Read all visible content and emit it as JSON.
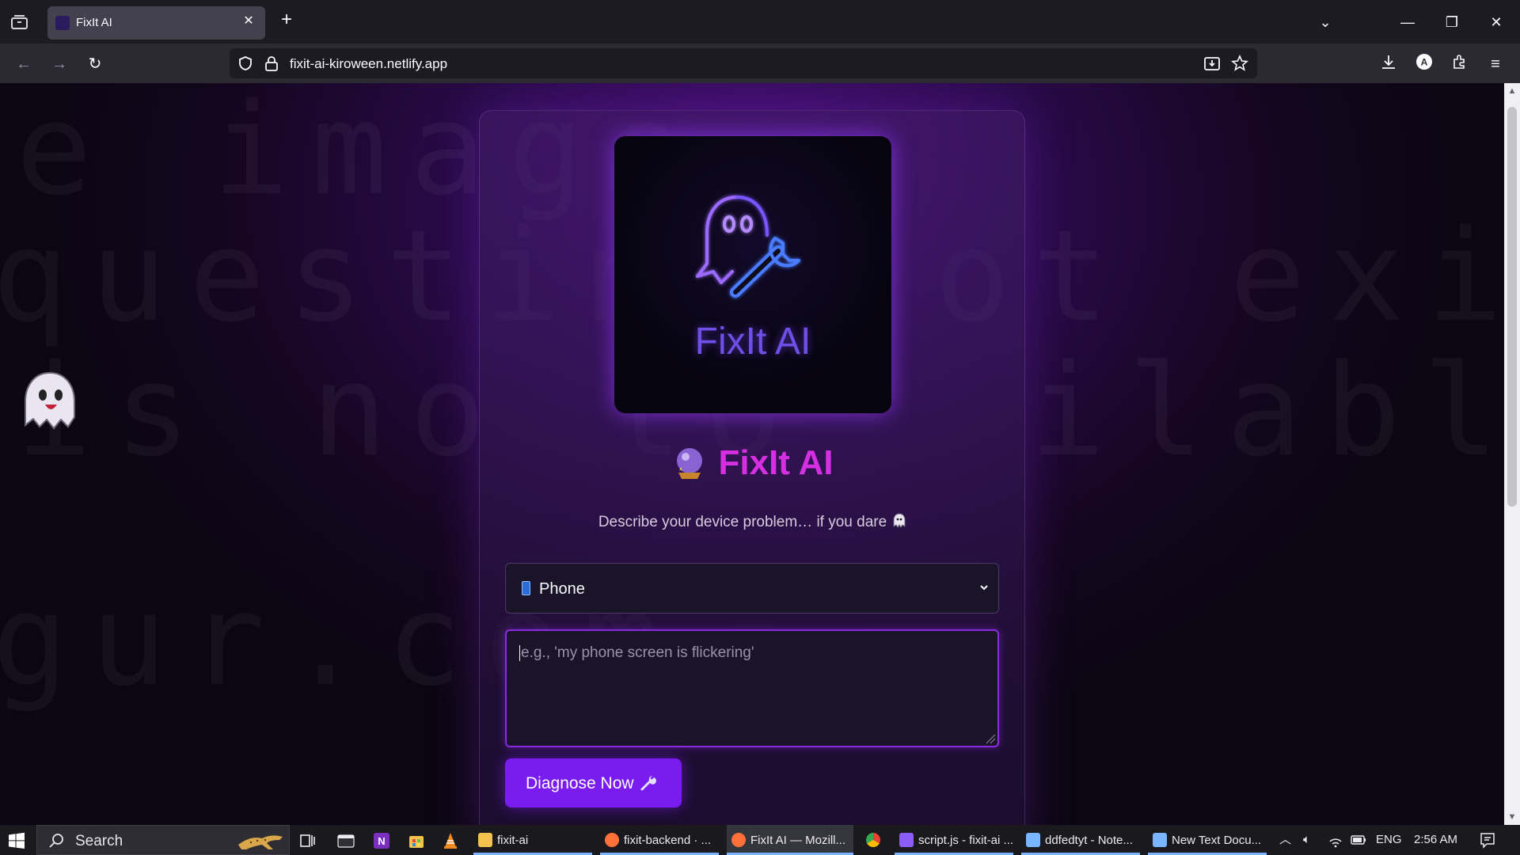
{
  "browser": {
    "tab_title": "FixIt AI",
    "url": "fixit-ai-kiroween.netlify.app"
  },
  "background_text": [
    "e image",
    "questing",
    "ot exist",
    "is no lo",
    "ilable.",
    "gur.com"
  ],
  "card": {
    "logo_text": "FixIt AI",
    "title": "FixIt AI",
    "tagline": "Describe your device problem… if you dare",
    "device_select": {
      "value": "Phone",
      "icon": "mobile-phone-icon"
    },
    "problem_input": {
      "placeholder": "e.g., 'my phone screen is flickering'",
      "value": ""
    },
    "diagnose_button": "Diagnose Now"
  },
  "taskbar": {
    "search_label": "Search",
    "apps": [
      {
        "label": "fixit-ai",
        "icon": "folder-icon",
        "color": "#f2c14e"
      },
      {
        "label": "fixit-backend · ...",
        "icon": "firefox-icon",
        "color": "#ff7139"
      },
      {
        "label": "FixIt AI — Mozill...",
        "icon": "firefox-icon",
        "color": "#ff7139"
      },
      {
        "label": "",
        "icon": "chrome-icon",
        "color": "#34a853"
      },
      {
        "label": "script.js - fixit-ai ...",
        "icon": "code-editor-icon",
        "color": "#8b5cf6"
      },
      {
        "label": "ddfedtyt - Note...",
        "icon": "notepad-icon",
        "color": "#7ab6ff"
      },
      {
        "label": "New Text Docu...",
        "icon": "notepad-icon",
        "color": "#7ab6ff"
      }
    ],
    "language": "ENG",
    "time": "2:56 AM"
  },
  "colors": {
    "accent_purple": "#7a1cf0",
    "title_magenta": "#d42fe0",
    "logo_text": "#6f4fe8"
  }
}
